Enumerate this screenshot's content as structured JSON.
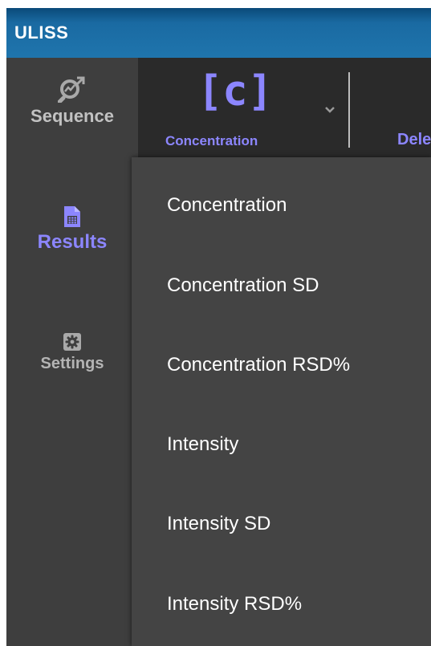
{
  "window": {
    "title": "ULISS"
  },
  "sidebar": {
    "items": [
      {
        "id": "sequence",
        "label": "Sequence",
        "icon": "analytics-magnifier-icon"
      },
      {
        "id": "results",
        "label": "Results",
        "icon": "document-report-icon",
        "active": true
      },
      {
        "id": "settings",
        "label": "Settings",
        "icon": "gear-icon"
      }
    ]
  },
  "toolbar": {
    "concentration_symbol": "[c]",
    "concentration_label": "Concentration",
    "chevron_icon": "chevron-down-icon",
    "delete_label": "Dele"
  },
  "dropdown": {
    "options": [
      "Concentration",
      "Concentration SD",
      "Concentration RSD%",
      "Intensity",
      "Intensity SD",
      "Intensity RSD%"
    ]
  },
  "colors": {
    "accent": "#8c86ff",
    "titlebar": "#1f75ad",
    "sidebar_bg": "#3e3e3e",
    "toolbar_bg": "#2a2a2a",
    "dropdown_bg": "#444444"
  }
}
